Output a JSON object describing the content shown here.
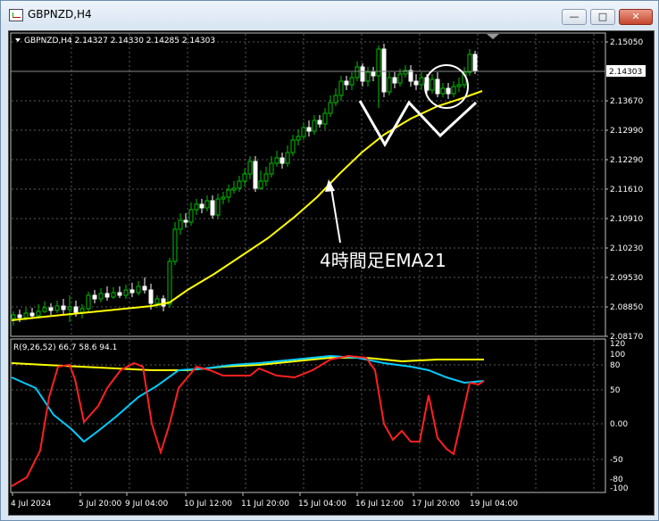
{
  "window": {
    "title": "GBPNZD,H4",
    "btn_minimize": "—",
    "btn_maximize": "□",
    "btn_close": "✕"
  },
  "main_chart": {
    "header": "GBPNZD,H4  2.14327 2.14330 2.14285 2.14303",
    "current_price": "2.14303",
    "price_axis": [
      "2.15050",
      "2.14303",
      "2.13670",
      "2.12990",
      "2.12290",
      "2.11610",
      "2.10910",
      "2.10230",
      "2.09530",
      "2.08850",
      "2.08170"
    ],
    "annotation": "4時間足EMA21",
    "colors": {
      "background": "#000000",
      "bull": "#00c000",
      "bear": "#ffffff",
      "ema": "#ffff00",
      "grid": "#5a5a5a"
    }
  },
  "indicator": {
    "header": "R(9,26,52) 66.7 58.6 94.1",
    "axis": [
      "120",
      "100",
      "80",
      "50",
      "0.00",
      "-50",
      "-80",
      "-100"
    ],
    "colors": {
      "line1": "#ffff00",
      "line2": "#00ccff",
      "line3": "#ff2020"
    }
  },
  "time_axis": [
    "4 Jul 2024",
    "5 Jul 20:00",
    "9 Jul 04:00",
    "10 Jul 12:00",
    "11 Jul 20:00",
    "15 Jul 04:00",
    "16 Jul 12:00",
    "17 Jul 20:00",
    "19 Jul 04:00"
  ]
}
